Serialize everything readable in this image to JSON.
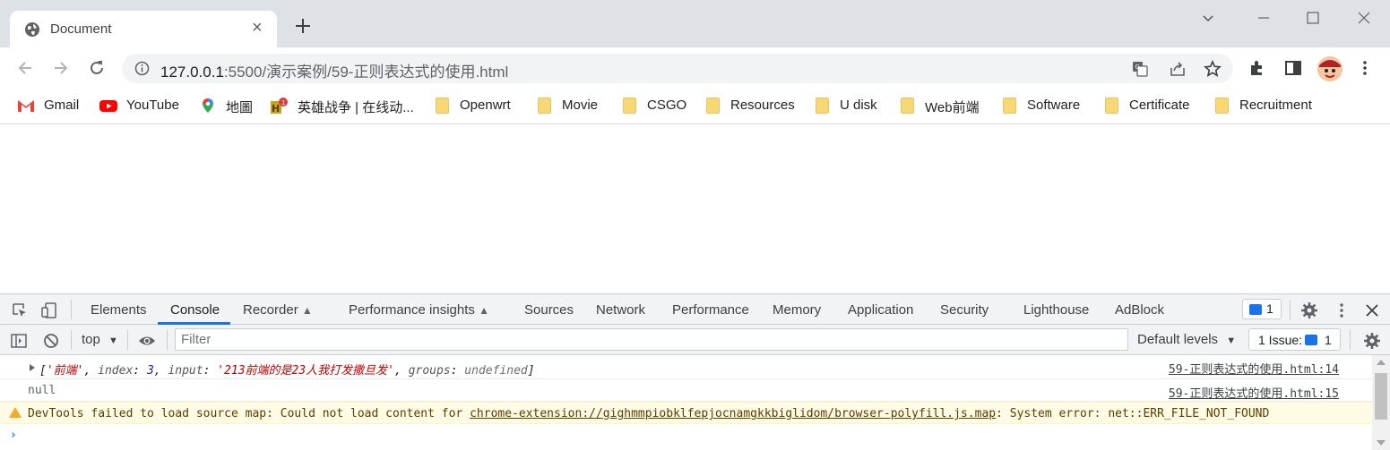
{
  "window": {
    "tab_title": "Document",
    "tab_close": "×",
    "new_tab": "+"
  },
  "omnibox": {
    "host": "127.0.0.1",
    "path": ":5500/演示案例/59-正则表达式的使用.html"
  },
  "bookmarks": [
    {
      "label": "Gmail",
      "icon": "gmail-icon"
    },
    {
      "label": "YouTube",
      "icon": "youtube-icon"
    },
    {
      "label": "地圖",
      "icon": "maps-icon"
    },
    {
      "label": "英雄战争 | 在线动...",
      "icon": "game-icon"
    },
    {
      "label": "Openwrt",
      "icon": "folder-icon"
    },
    {
      "label": "Movie",
      "icon": "folder-icon"
    },
    {
      "label": "CSGO",
      "icon": "folder-icon"
    },
    {
      "label": "Resources",
      "icon": "folder-icon"
    },
    {
      "label": "U disk",
      "icon": "folder-icon"
    },
    {
      "label": "Web前端",
      "icon": "folder-icon"
    },
    {
      "label": "Software",
      "icon": "folder-icon"
    },
    {
      "label": "Certificate",
      "icon": "folder-icon"
    },
    {
      "label": "Recruitment",
      "icon": "folder-icon"
    }
  ],
  "devtools": {
    "tabs": [
      "Elements",
      "Console",
      "Recorder",
      "Performance insights",
      "Sources",
      "Network",
      "Performance",
      "Memory",
      "Application",
      "Security",
      "Lighthouse",
      "AdBlock"
    ],
    "active_tab": "Console",
    "message_count": "1",
    "context": "top",
    "filter_placeholder": "Filter",
    "levels": "Default levels",
    "issues_label": "1 Issue:",
    "issues_count": "1",
    "console": {
      "row1": {
        "open": "[",
        "match": "'前端'",
        "sep1": ", ",
        "index_key": "index",
        "colon1": ": ",
        "index_val": "3",
        "sep2": ", ",
        "input_key": "input",
        "colon2": ": ",
        "input_val": "'213前端的是23人我打发撒旦发'",
        "sep3": ", ",
        "groups_key": "groups",
        "colon3": ": ",
        "groups_val": "undefined",
        "close": "]",
        "source": "59-正则表达式的使用.html:14"
      },
      "row2": {
        "value": "null",
        "source": "59-正则表达式的使用.html:15"
      },
      "warning": {
        "prefix": "DevTools failed to load source map: Could not load content for ",
        "link": "chrome-extension://gighmmpiobklfepjocnamgkkbiglidom/browser-polyfill.js.map",
        "suffix": ": System error: net::ERR_FILE_NOT_FOUND"
      },
      "prompt": "›"
    }
  },
  "colors": {
    "accent": "#1a73e8",
    "warning_bg": "#fffbe5",
    "warning_icon": "#f2ab26"
  }
}
